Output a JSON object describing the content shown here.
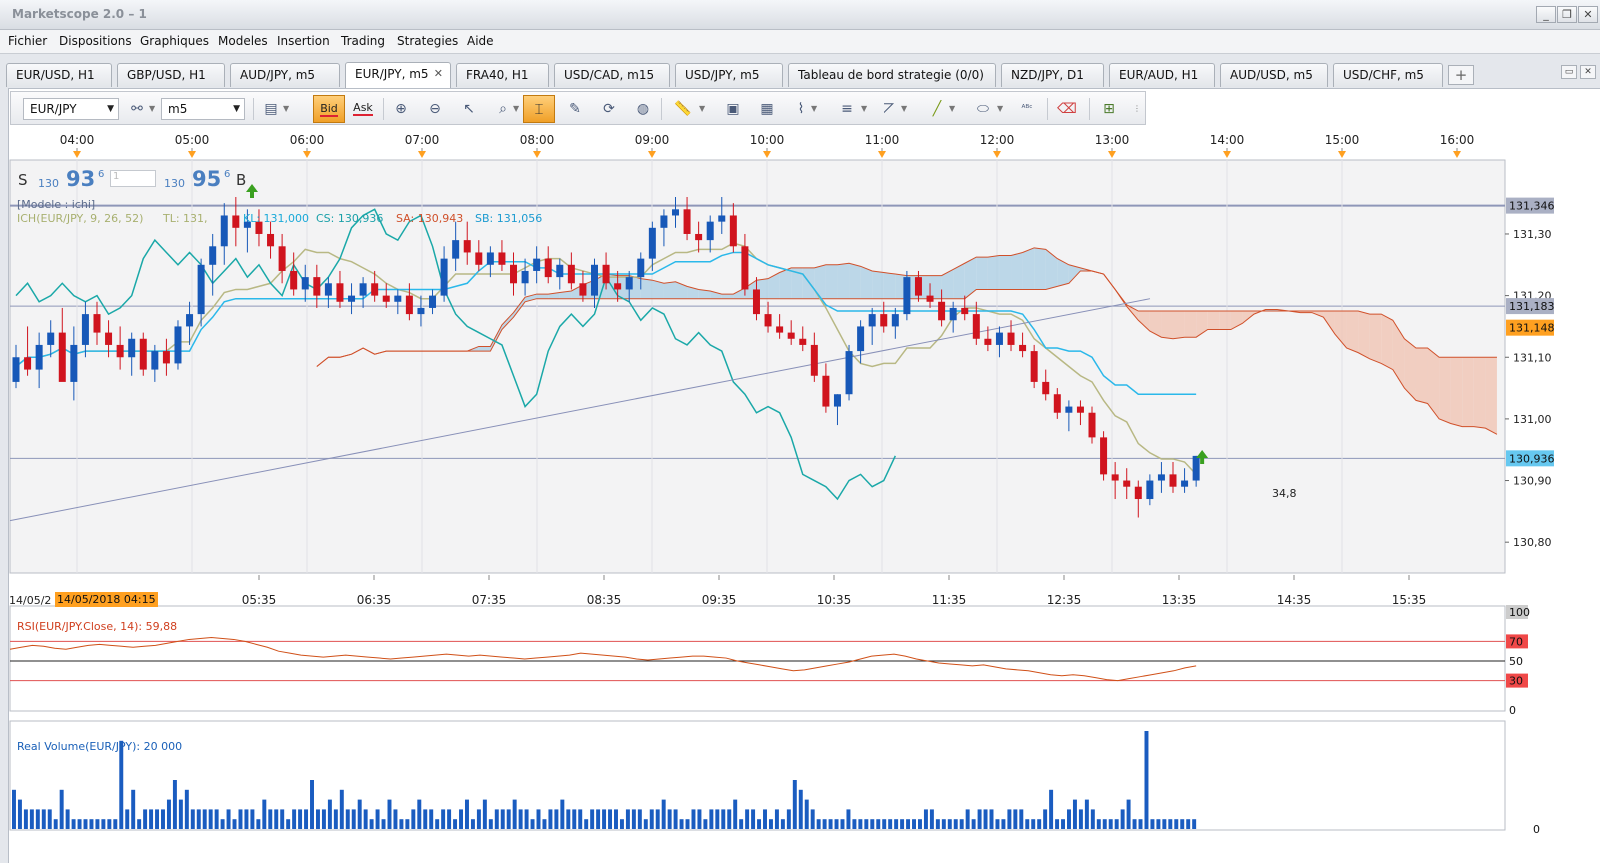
{
  "window": {
    "title": "Marketscope 2.0 – 1",
    "controls": [
      "_",
      "❐",
      "✕"
    ]
  },
  "menu": [
    "Fichier",
    "Dispositions",
    "Graphiques",
    "Modeles",
    "Insertion",
    "Trading",
    "Strategies",
    "Aide"
  ],
  "tabs": [
    {
      "label": "EUR/USD, H1"
    },
    {
      "label": "GBP/USD, H1"
    },
    {
      "label": "AUD/JPY, m5"
    },
    {
      "label": "EUR/JPY, m5",
      "active": true
    },
    {
      "label": "FRA40, H1"
    },
    {
      "label": "USD/CAD, m15"
    },
    {
      "label": "USD/JPY, m5"
    },
    {
      "label": "Tableau de bord strategie (0/0)"
    },
    {
      "label": "NZD/JPY, D1"
    },
    {
      "label": "EUR/AUD, H1"
    },
    {
      "label": "AUD/USD, m5"
    },
    {
      "label": "USD/CHF, m5"
    }
  ],
  "add_tab": "+",
  "toolbar": {
    "instrument": "EUR/JPY",
    "timeframe": "m5",
    "bid_label": "Bid",
    "ask_label": "Ask"
  },
  "quote": {
    "sell_label": "S",
    "sell_big": "130",
    "sell_pips": "93",
    "sell_frac": "6",
    "lots": "1",
    "buy_big": "130",
    "buy_pips": "95",
    "buy_frac": "6",
    "buy_label": "B"
  },
  "chart_data": {
    "type": "candlestick",
    "instrument": "EUR/JPY",
    "timeframe": "m5",
    "top_time_labels": [
      "04:00",
      "05:00",
      "06:00",
      "07:00",
      "08:00",
      "09:00",
      "10:00",
      "11:00",
      "12:00",
      "13:00",
      "14:00",
      "15:00",
      "16:00"
    ],
    "bottom_time_labels": [
      "05:35",
      "06:35",
      "07:35",
      "08:35",
      "09:35",
      "10:35",
      "11:35",
      "12:35",
      "13:35",
      "14:35",
      "15:35"
    ],
    "date_prefix": "14/05/2",
    "date_highlight": "14/05/2018 04:15",
    "y_ticks": [
      "131,30",
      "131,20",
      "131,10",
      "131,00",
      "130,90",
      "130,80"
    ],
    "ylim": [
      130.75,
      131.42
    ],
    "price_tags": [
      {
        "label": "131,346",
        "value": 131.346,
        "color": "#aab0c4"
      },
      {
        "label": "131,183",
        "value": 131.183,
        "color": "#aab0c4"
      },
      {
        "label": "131,148",
        "value": 131.148,
        "color": "#ffa020"
      },
      {
        "label": "130,936",
        "value": 130.936,
        "color": "#66c8f0"
      }
    ],
    "legend_model": "[Modele : ichi]",
    "legend_ichi": "ICH(EUR/JPY, 9, 26, 52)",
    "legend_tl": "TL: 131,",
    "legend_kl": "KL: 131,000",
    "legend_cs": "CS: 130,936",
    "legend_sa": "SA: 130,943",
    "legend_sb": "SB: 131,056",
    "last_label": "34,8",
    "candles": [
      [
        131.06,
        131.12,
        131.05,
        131.1
      ],
      [
        131.1,
        131.15,
        131.07,
        131.08
      ],
      [
        131.08,
        131.14,
        131.05,
        131.12
      ],
      [
        131.12,
        131.16,
        131.1,
        131.14
      ],
      [
        131.14,
        131.18,
        131.08,
        131.06
      ],
      [
        131.06,
        131.15,
        131.03,
        131.12
      ],
      [
        131.12,
        131.19,
        131.1,
        131.17
      ],
      [
        131.17,
        131.19,
        131.12,
        131.14
      ],
      [
        131.14,
        131.16,
        131.1,
        131.12
      ],
      [
        131.12,
        131.15,
        131.08,
        131.1
      ],
      [
        131.1,
        131.14,
        131.07,
        131.13
      ],
      [
        131.13,
        131.14,
        131.07,
        131.08
      ],
      [
        131.08,
        131.12,
        131.06,
        131.11
      ],
      [
        131.11,
        131.13,
        131.07,
        131.09
      ],
      [
        131.09,
        131.16,
        131.08,
        131.15
      ],
      [
        131.15,
        131.19,
        131.12,
        131.17
      ],
      [
        131.17,
        131.26,
        131.15,
        131.25
      ],
      [
        131.25,
        131.3,
        131.2,
        131.28
      ],
      [
        131.28,
        131.35,
        131.25,
        131.33
      ],
      [
        131.33,
        131.36,
        131.28,
        131.31
      ],
      [
        131.31,
        131.34,
        131.27,
        131.32
      ],
      [
        131.32,
        131.34,
        131.28,
        131.3
      ],
      [
        131.3,
        131.32,
        131.26,
        131.28
      ],
      [
        131.28,
        131.3,
        131.22,
        131.24
      ],
      [
        131.24,
        131.27,
        131.2,
        131.21
      ],
      [
        131.21,
        131.25,
        131.19,
        131.23
      ],
      [
        131.23,
        131.25,
        131.18,
        131.2
      ],
      [
        131.2,
        131.23,
        131.18,
        131.22
      ],
      [
        131.22,
        131.24,
        131.18,
        131.19
      ],
      [
        131.19,
        131.22,
        131.17,
        131.2
      ],
      [
        131.2,
        131.23,
        131.18,
        131.22
      ],
      [
        131.22,
        131.24,
        131.19,
        131.2
      ],
      [
        131.2,
        131.22,
        131.18,
        131.19
      ],
      [
        131.19,
        131.21,
        131.17,
        131.2
      ],
      [
        131.2,
        131.22,
        131.16,
        131.17
      ],
      [
        131.17,
        131.2,
        131.15,
        131.18
      ],
      [
        131.18,
        131.21,
        131.17,
        131.2
      ],
      [
        131.2,
        131.28,
        131.19,
        131.26
      ],
      [
        131.26,
        131.32,
        131.24,
        131.29
      ],
      [
        131.29,
        131.32,
        131.25,
        131.27
      ],
      [
        131.27,
        131.29,
        131.24,
        131.25
      ],
      [
        131.25,
        131.28,
        131.23,
        131.27
      ],
      [
        131.27,
        131.29,
        131.24,
        131.25
      ],
      [
        131.25,
        131.27,
        131.2,
        131.22
      ],
      [
        131.22,
        131.26,
        131.2,
        131.24
      ],
      [
        131.24,
        131.28,
        131.22,
        131.26
      ],
      [
        131.26,
        131.28,
        131.22,
        131.23
      ],
      [
        131.23,
        131.26,
        131.21,
        131.25
      ],
      [
        131.25,
        131.27,
        131.21,
        131.22
      ],
      [
        131.22,
        131.24,
        131.19,
        131.2
      ],
      [
        131.2,
        131.26,
        131.18,
        131.25
      ],
      [
        131.25,
        131.27,
        131.21,
        131.22
      ],
      [
        131.22,
        131.24,
        131.19,
        131.21
      ],
      [
        131.21,
        131.24,
        131.19,
        131.23
      ],
      [
        131.23,
        131.27,
        131.21,
        131.26
      ],
      [
        131.26,
        131.32,
        131.24,
        131.31
      ],
      [
        131.31,
        131.34,
        131.28,
        131.33
      ],
      [
        131.33,
        131.36,
        131.31,
        131.34
      ],
      [
        131.34,
        131.36,
        131.29,
        131.3
      ],
      [
        131.3,
        131.32,
        131.27,
        131.29
      ],
      [
        131.29,
        131.33,
        131.27,
        131.32
      ],
      [
        131.32,
        131.36,
        131.3,
        131.33
      ],
      [
        131.33,
        131.35,
        131.27,
        131.28
      ],
      [
        131.28,
        131.3,
        131.2,
        131.21
      ],
      [
        131.21,
        131.23,
        131.16,
        131.17
      ],
      [
        131.17,
        131.19,
        131.14,
        131.15
      ],
      [
        131.15,
        131.17,
        131.13,
        131.14
      ],
      [
        131.14,
        131.16,
        131.12,
        131.13
      ],
      [
        131.13,
        131.15,
        131.11,
        131.12
      ],
      [
        131.12,
        131.14,
        131.06,
        131.07
      ],
      [
        131.07,
        131.09,
        131.01,
        131.02
      ],
      [
        131.02,
        131.04,
        130.99,
        131.04
      ],
      [
        131.04,
        131.12,
        131.03,
        131.11
      ],
      [
        131.11,
        131.16,
        131.09,
        131.15
      ],
      [
        131.15,
        131.18,
        131.12,
        131.17
      ],
      [
        131.17,
        131.19,
        131.14,
        131.15
      ],
      [
        131.15,
        131.18,
        131.13,
        131.17
      ],
      [
        131.17,
        131.24,
        131.16,
        131.23
      ],
      [
        131.23,
        131.24,
        131.19,
        131.2
      ],
      [
        131.2,
        131.22,
        131.18,
        131.19
      ],
      [
        131.19,
        131.21,
        131.15,
        131.16
      ],
      [
        131.16,
        131.19,
        131.14,
        131.18
      ],
      [
        131.18,
        131.2,
        131.16,
        131.17
      ],
      [
        131.17,
        131.19,
        131.12,
        131.13
      ],
      [
        131.13,
        131.15,
        131.11,
        131.12
      ],
      [
        131.12,
        131.15,
        131.1,
        131.14
      ],
      [
        131.14,
        131.16,
        131.11,
        131.12
      ],
      [
        131.12,
        131.14,
        131.1,
        131.11
      ],
      [
        131.11,
        131.12,
        131.05,
        131.06
      ],
      [
        131.06,
        131.08,
        131.03,
        131.04
      ],
      [
        131.04,
        131.05,
        131.0,
        131.01
      ],
      [
        131.01,
        131.03,
        130.98,
        131.02
      ],
      [
        131.02,
        131.03,
        130.99,
        131.01
      ],
      [
        131.01,
        131.02,
        130.96,
        130.97
      ],
      [
        130.97,
        130.98,
        130.9,
        130.91
      ],
      [
        130.91,
        130.93,
        130.87,
        130.9
      ],
      [
        130.9,
        130.92,
        130.87,
        130.89
      ],
      [
        130.89,
        130.9,
        130.84,
        130.87
      ],
      [
        130.87,
        130.91,
        130.86,
        130.9
      ],
      [
        130.9,
        130.93,
        130.88,
        130.91
      ],
      [
        130.91,
        130.93,
        130.88,
        130.89
      ],
      [
        130.89,
        130.92,
        130.88,
        130.9
      ],
      [
        130.9,
        130.94,
        130.89,
        130.94
      ]
    ],
    "rsi": {
      "label": "RSI(EUR/JPY.Close, 14): 59,88",
      "levels": [
        "100",
        "70",
        "50",
        "30",
        "0"
      ],
      "values": [
        62,
        64,
        66,
        65,
        63,
        62,
        64,
        66,
        67,
        66,
        65,
        64,
        65,
        66,
        68,
        70,
        72,
        73,
        74,
        73,
        72,
        70,
        67,
        64,
        60,
        58,
        56,
        55,
        54,
        55,
        56,
        55,
        54,
        53,
        52,
        53,
        54,
        55,
        56,
        57,
        56,
        55,
        56,
        55,
        54,
        53,
        52,
        53,
        54,
        55,
        56,
        58,
        57,
        56,
        55,
        54,
        52,
        51,
        52,
        53,
        54,
        55,
        55,
        54,
        53,
        50,
        48,
        46,
        44,
        42,
        40,
        41,
        43,
        45,
        47,
        49,
        52,
        55,
        56,
        57,
        55,
        52,
        50,
        48,
        47,
        46,
        45,
        46,
        44,
        42,
        41,
        40,
        38,
        36,
        35,
        36,
        35,
        33,
        31,
        30,
        32,
        34,
        36,
        38,
        40,
        43,
        45
      ]
    },
    "volume": {
      "label": "Real Volume(EUR/JPY): 20 000",
      "zero": "0",
      "values": [
        4,
        3,
        2,
        2,
        2,
        2,
        2,
        1,
        4,
        2,
        1,
        1,
        1,
        1,
        1,
        1,
        1,
        1,
        9,
        2,
        4,
        1,
        2,
        2,
        2,
        2,
        3,
        5,
        3,
        4,
        2,
        2,
        2,
        2,
        2,
        1,
        2,
        1,
        2,
        2,
        2,
        1,
        3,
        2,
        2,
        2,
        1,
        2,
        2,
        2,
        5,
        2,
        2,
        3,
        2,
        4,
        2,
        2,
        3,
        2,
        1,
        2,
        1,
        3,
        2,
        1,
        1,
        2,
        3,
        2,
        2,
        1,
        2,
        2,
        1,
        2,
        3,
        1,
        2,
        3,
        1,
        2,
        2,
        2,
        3,
        2,
        2,
        1,
        2,
        1,
        2,
        2,
        3,
        2,
        2,
        2,
        1,
        2,
        2,
        2,
        2,
        2,
        1,
        2,
        2,
        2,
        1,
        2,
        2,
        3,
        2,
        2,
        1,
        1,
        2,
        2,
        1,
        2,
        2,
        2,
        2,
        3,
        1,
        2,
        2,
        1,
        2,
        1,
        2,
        1,
        2,
        5,
        4,
        3,
        2,
        1,
        1,
        1,
        1,
        1,
        2,
        1,
        1,
        1,
        1,
        1,
        1,
        1,
        1,
        1,
        1,
        1,
        1,
        2,
        2,
        1,
        1,
        1,
        1,
        1,
        2,
        1,
        2,
        2,
        2,
        1,
        1,
        2,
        2,
        2,
        1,
        1,
        1,
        2,
        4,
        1,
        1,
        2,
        3,
        2,
        3,
        2,
        1,
        1,
        1,
        1,
        2,
        3,
        1,
        1,
        10,
        1,
        1,
        1,
        1,
        1,
        1,
        1,
        1,
        0
      ]
    }
  }
}
